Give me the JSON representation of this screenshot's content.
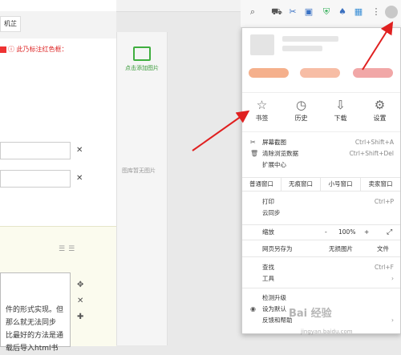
{
  "page": {
    "left_chip": "机芷",
    "left_notice": "ⓘ 此乃标注红色框：",
    "editor_lines": [
      "件的形式实现。但",
      "那么就无法同步",
      "比最好的方法是通",
      "载后导入html书"
    ],
    "gallery_add": "点击添加图片",
    "gallery_empty": "图库暂无图片"
  },
  "browser": {
    "toolbar_icons": [
      "search-icon",
      "cart-icon",
      "scissors-icon",
      "translate-icon",
      "shield-icon",
      "bell-icon",
      "keyboard-icon",
      "more-icon",
      "avatar"
    ]
  },
  "menu": {
    "quick": [
      {
        "label": "书签",
        "icon": "star-icon",
        "glyph": "☆"
      },
      {
        "label": "历史",
        "icon": "clock-icon",
        "glyph": "◷"
      },
      {
        "label": "下载",
        "icon": "download-icon",
        "glyph": "⇩"
      },
      {
        "label": "设置",
        "icon": "gear-icon",
        "glyph": "⚙"
      }
    ],
    "screenshot": {
      "label": "屏幕截图",
      "shortcut": "Ctrl+Shift+A"
    },
    "clear": {
      "label": "清除浏览数据",
      "shortcut": "Ctrl+Shift+Del"
    },
    "extensions": {
      "label": "扩展中心"
    },
    "windows": [
      "普通窗口",
      "无痕窗口",
      "小号窗口",
      "卖家窗口"
    ],
    "print": {
      "label": "打印",
      "shortcut": "Ctrl+P"
    },
    "cloud_sync": {
      "label": "云同步"
    },
    "zoom": {
      "label": "缩放",
      "minus": "-",
      "value": "100%",
      "plus": "+"
    },
    "save_as": {
      "label": "网页另存为",
      "image": "无损图片",
      "file": "文件"
    },
    "find": {
      "label": "查找",
      "shortcut": "Ctrl+F"
    },
    "tools": {
      "label": "工具"
    },
    "upgrade": {
      "label": "检测升级"
    },
    "default": {
      "label": "设为默认"
    },
    "feedback": {
      "label": "反馈和帮助"
    }
  },
  "watermark": {
    "text": "Bai 经验",
    "sub": "jingyan.baidu.com"
  },
  "colors": {
    "arrow": "#e02020",
    "accent": "#3fae3f"
  }
}
